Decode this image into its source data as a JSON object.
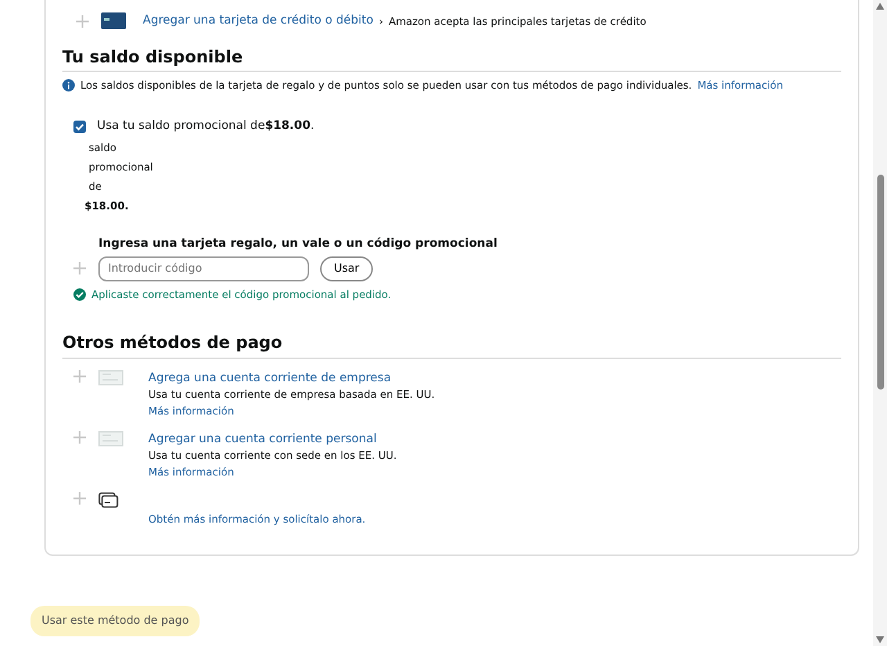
{
  "add_card": {
    "link": "Agregar una tarjeta de crédito o débito",
    "separator": "›",
    "note": "Amazon acepta las principales tarjetas de crédito"
  },
  "balance": {
    "heading": "Tu saldo disponible",
    "info": {
      "text": "Los saldos disponibles de la tarjeta de regalo y de puntos solo se pueden usar con tus métodos de pago individuales.",
      "link": "Más información"
    },
    "promo": {
      "label": "Usa tu saldo promocional de**$18.00**.",
      "checked": true,
      "lines": [
        "saldo",
        "promocional",
        "de"
      ],
      "amount": "$18.00."
    },
    "code": {
      "label": "Ingresa una tarjeta regalo, un vale o un código promocional",
      "placeholder": "Introducir código",
      "button": "Usar",
      "success": "Aplicaste correctamente el código promocional al pedido."
    }
  },
  "other": {
    "heading": "Otros métodos de pago",
    "methods": [
      {
        "kind": "bank",
        "title": "Agrega una cuenta corriente de empresa",
        "description": "Usa tu cuenta corriente de empresa basada en EE. UU.",
        "link": "Más información"
      },
      {
        "kind": "bank",
        "title": "Agregar una cuenta corriente personal",
        "description": "Usa tu cuenta corriente con sede en los EE. UU.",
        "link": "Más información"
      },
      {
        "kind": "credit",
        "link": "Obtén más información y solicítalo ahora."
      }
    ]
  },
  "submit": {
    "label": "Usar este método de pago",
    "disabled": true
  }
}
